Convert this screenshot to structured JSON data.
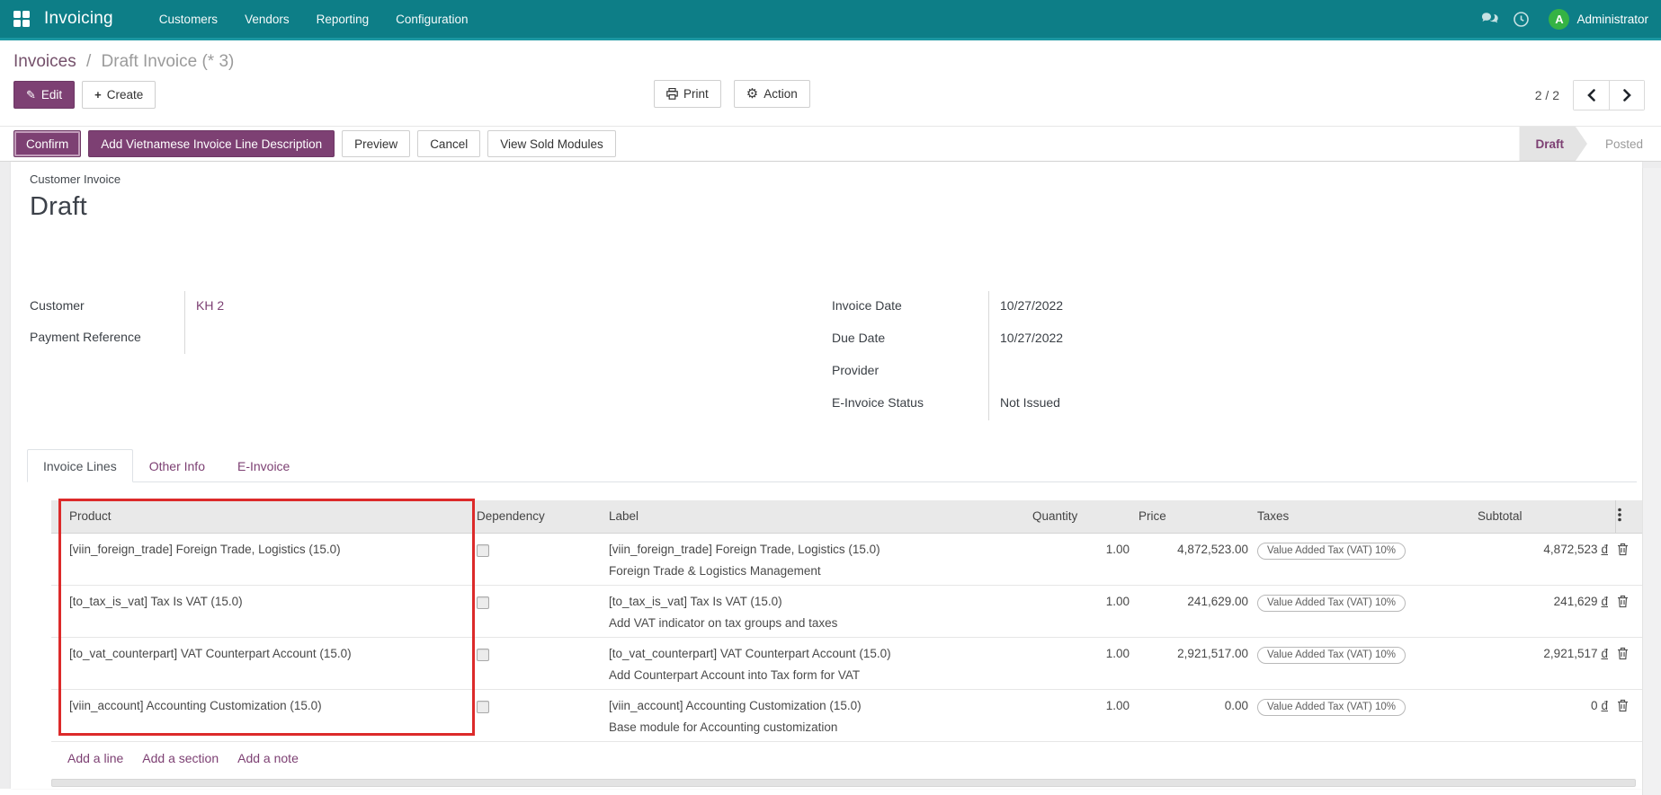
{
  "colors": {
    "navbar_teal": "#0d7e87",
    "accent_purple": "#7d4073",
    "avatar_green": "#35b344",
    "annotation_red": "#dc2a2a",
    "status_active_bg": "#e4e4e4"
  },
  "topbar": {
    "app_name": "Invoicing",
    "menus": [
      "Customers",
      "Vendors",
      "Reporting",
      "Configuration"
    ],
    "user": {
      "initial": "A",
      "name": "Administrator"
    }
  },
  "breadcrumb": {
    "parent": "Invoices",
    "separator": "/",
    "current": "Draft Invoice (* 3)"
  },
  "actions": {
    "edit": "Edit",
    "create": "Create",
    "print": "Print",
    "action": "Action",
    "pager": {
      "count": "2 / 2"
    }
  },
  "icons": {
    "edit_pencil": "✎",
    "create_plus": "+",
    "action_gear": "⚙"
  },
  "statusbar": {
    "buttons": [
      {
        "label": "Confirm",
        "style": "primary"
      },
      {
        "label": "Add Vietnamese Invoice Line Description",
        "style": "primary"
      },
      {
        "label": "Preview",
        "style": "secondary"
      },
      {
        "label": "Cancel",
        "style": "secondary"
      },
      {
        "label": "View Sold Modules",
        "style": "secondary"
      }
    ],
    "states": [
      {
        "label": "Draft",
        "active": true
      },
      {
        "label": "Posted",
        "active": false
      }
    ]
  },
  "form": {
    "type_label": "Customer Invoice",
    "title": "Draft",
    "left_fields": [
      {
        "label": "Customer",
        "value": "KH 2"
      },
      {
        "label": "Payment Reference",
        "value": ""
      }
    ],
    "right_fields": [
      {
        "label": "Invoice Date",
        "value": "10/27/2022"
      },
      {
        "label": "Due Date",
        "value": "10/27/2022"
      },
      {
        "label": "Provider",
        "value": ""
      },
      {
        "label": "E-Invoice Status",
        "value": "Not Issued"
      }
    ]
  },
  "tabs": [
    {
      "label": "Invoice Lines",
      "active": true
    },
    {
      "label": "Other Info",
      "active": false
    },
    {
      "label": "E-Invoice",
      "active": false
    }
  ],
  "table": {
    "columns": [
      "Product",
      "Dependency",
      "Label",
      "Quantity",
      "Price",
      "Taxes",
      "Subtotal"
    ],
    "currency": "đ",
    "rows": [
      {
        "product": "[viin_foreign_trade] Foreign Trade, Logistics (15.0)",
        "label_line1": "[viin_foreign_trade] Foreign Trade, Logistics (15.0)",
        "label_line2": "Foreign Trade & Logistics Management",
        "quantity": "1.00",
        "price": "4,872,523.00",
        "tax": "Value Added Tax (VAT) 10%",
        "subtotal": "4,872,523"
      },
      {
        "product": "[to_tax_is_vat] Tax Is VAT (15.0)",
        "label_line1": "[to_tax_is_vat] Tax Is VAT (15.0)",
        "label_line2": "Add VAT indicator on tax groups and taxes",
        "quantity": "1.00",
        "price": "241,629.00",
        "tax": "Value Added Tax (VAT) 10%",
        "subtotal": "241,629"
      },
      {
        "product": "[to_vat_counterpart] VAT Counterpart Account (15.0)",
        "label_line1": "[to_vat_counterpart] VAT Counterpart Account (15.0)",
        "label_line2": "Add Counterpart Account into Tax form for VAT",
        "quantity": "1.00",
        "price": "2,921,517.00",
        "tax": "Value Added Tax (VAT) 10%",
        "subtotal": "2,921,517"
      },
      {
        "product": "[viin_account] Accounting Customization (15.0)",
        "label_line1": "[viin_account] Accounting Customization (15.0)",
        "label_line2": "Base module for Accounting customization",
        "quantity": "1.00",
        "price": "0.00",
        "tax": "Value Added Tax (VAT) 10%",
        "subtotal": "0"
      }
    ],
    "footer_links": [
      "Add a line",
      "Add a section",
      "Add a note"
    ]
  }
}
